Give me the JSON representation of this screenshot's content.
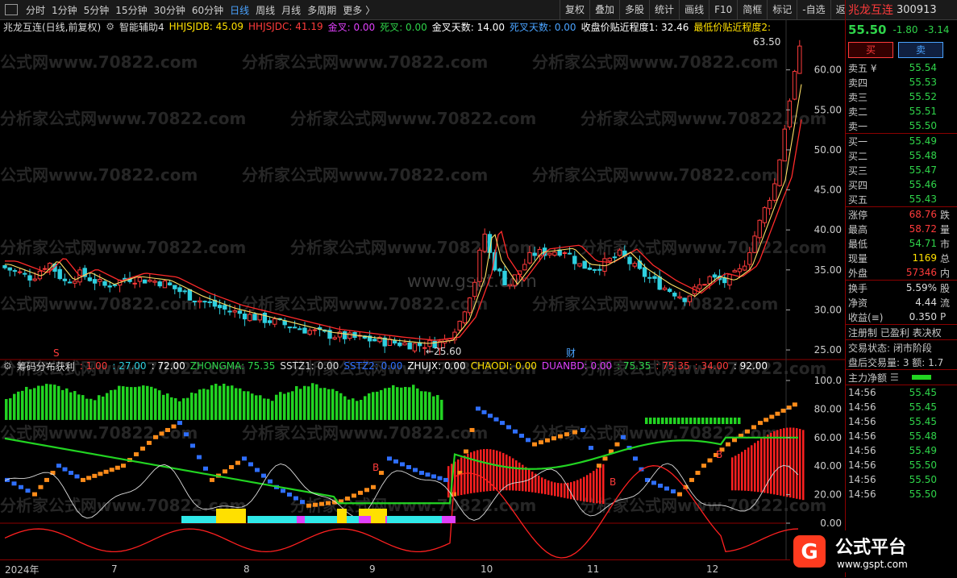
{
  "toolbar": {
    "periods": [
      "分时",
      "1分钟",
      "5分钟",
      "15分钟",
      "30分钟",
      "60分钟",
      "日线",
      "周线",
      "月线",
      "多周期",
      "更多"
    ],
    "active_period": "日线",
    "right_tools": [
      "复权",
      "叠加",
      "多股",
      "统计",
      "画线",
      "F10",
      "简框",
      "标记",
      "-自选",
      "返回"
    ]
  },
  "main_info": {
    "title": "兆龙互连(日线,前复权)",
    "indicator": "智能辅助4",
    "hhjsjdb": "HHJSJDB: 45.09",
    "hhjsjdc": "HHJSJDC: 41.19",
    "jincha": "金叉: 0.00",
    "sicha": "死叉: 0.00",
    "jincha_days": "金叉天数: 14.00",
    "sicha_days": "死叉天数: 0.00",
    "close_near": "收盘价贴近程度1: 32.46",
    "low_near": "最低价贴近程度2:"
  },
  "sub_info": {
    "name": "筹码分布获利",
    "v1": ": 1.00",
    "v2": ": 27.00",
    "v3": ": 72.00",
    "zhongma": "ZHONGMA: 75.35",
    "sstz1": "SSTZ1: 0.00",
    "sstz2": "SSTZ2: 0.00",
    "zhujx": "ZHUJX: 0.00",
    "chaodi": "CHAODI: 0.00",
    "duanbd": "DUANBD: 0.00",
    "v4": ": 75.35",
    "v5": ": 75.35",
    "v6": ": 34.00",
    "v7": ": 92.00"
  },
  "price_axis": [
    "60.00",
    "55.00",
    "50.00",
    "45.00",
    "40.00",
    "35.00",
    "30.00",
    "25.00"
  ],
  "sub_axis": [
    "100.0",
    "80.00",
    "60.00",
    "40.00",
    "20.00",
    "0.00"
  ],
  "annotations": {
    "high": "63.50",
    "low": "25.60",
    "mark_s": "S",
    "mark_cai": "财",
    "mark_b": "B"
  },
  "watermark": "分析家公式网www.70822.com",
  "watermark2": "www.gspt.com",
  "time_axis": [
    "2024年",
    "7",
    "8",
    "9",
    "10",
    "11",
    "12"
  ],
  "quote": {
    "name": "兆龙互连",
    "code": "300913",
    "price": "55.50",
    "change": "-1.80",
    "pct": "-3.14",
    "buy_label": "买",
    "sell_label": "卖",
    "asks": [
      [
        "卖五 ¥",
        "55.54"
      ],
      [
        "卖四",
        "55.53"
      ],
      [
        "卖三",
        "55.52"
      ],
      [
        "卖二",
        "55.51"
      ],
      [
        "卖一",
        "55.50"
      ]
    ],
    "bids": [
      [
        "买一",
        "55.49"
      ],
      [
        "买二",
        "55.48"
      ],
      [
        "买三",
        "55.47"
      ],
      [
        "买四",
        "55.46"
      ],
      [
        "买五",
        "55.43"
      ]
    ],
    "stats": [
      [
        "涨停",
        "68.76",
        "跌"
      ],
      [
        "最高",
        "58.72",
        "量"
      ],
      [
        "最低",
        "54.71",
        "市"
      ],
      [
        "现量",
        "1169",
        "总"
      ],
      [
        "外盘",
        "57346",
        "内"
      ]
    ],
    "stats2": [
      [
        "换手",
        "5.59%",
        "股"
      ],
      [
        "净资",
        "4.44",
        "流"
      ],
      [
        "收益(≡)",
        "0.350",
        "P"
      ]
    ],
    "flags": "注册制 已盈利 表决权",
    "status": "交易状态: 闭市阶段",
    "after": "盘后交易量: 3  额: 1.7",
    "netflow": "主力净额",
    "ticks": [
      [
        "14:56",
        "55.45"
      ],
      [
        "14:56",
        "55.45"
      ],
      [
        "14:56",
        "55.45"
      ],
      [
        "14:56",
        "55.48"
      ],
      [
        "14:56",
        "55.49"
      ],
      [
        "14:56",
        "55.50"
      ],
      [
        "14:56",
        "55.50"
      ],
      [
        "14:56",
        "55.50"
      ]
    ]
  },
  "logo": {
    "text": "公式平台",
    "url": "www.gspt.com"
  },
  "colors": {
    "up": "#ff3b3b",
    "down": "#2fd0e0",
    "ma1": "#ffe066",
    "ma2": "#ff2a2a",
    "green": "#22d422",
    "orange": "#ff8c1a",
    "blue": "#2f6fff"
  }
}
